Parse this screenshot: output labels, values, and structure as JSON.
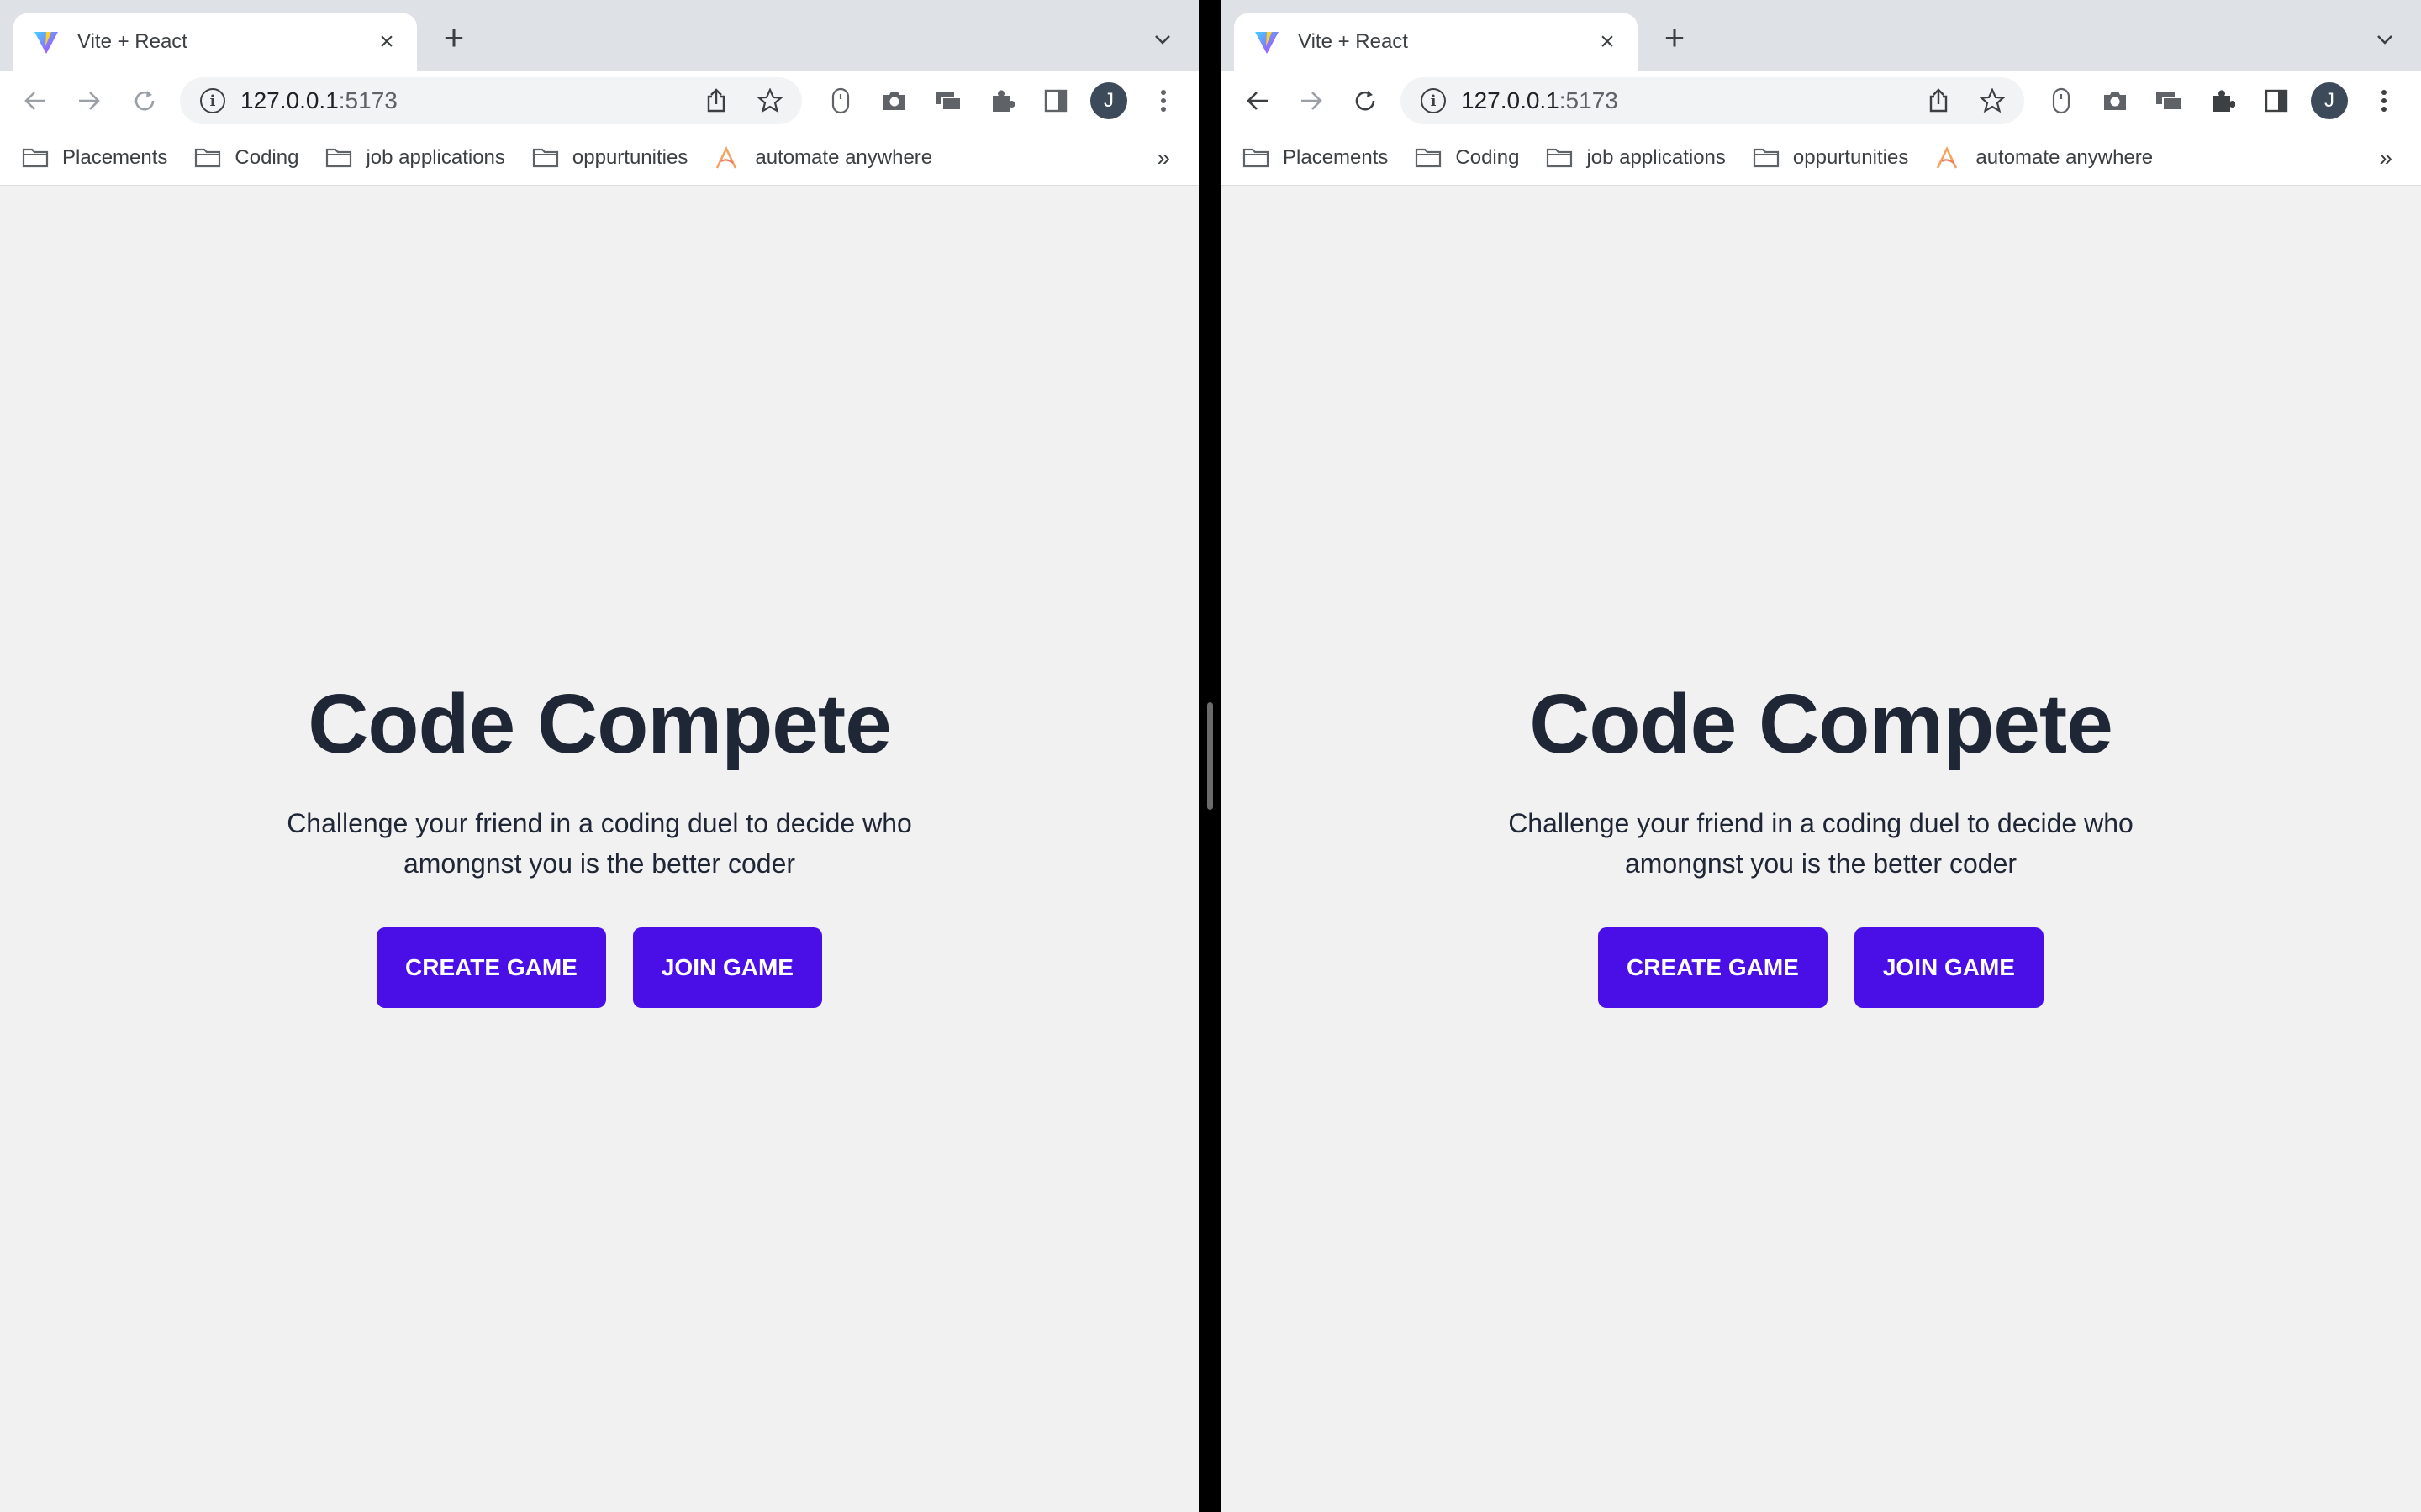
{
  "colors": {
    "accent": "#4a0fe6",
    "heading": "#1f2635",
    "page_bg": "#f1f1f2",
    "tabstrip_bg": "#dee1e6"
  },
  "windows": [
    {
      "tab": {
        "title": "Vite + React",
        "close": "×",
        "favicon": "vite-icon"
      },
      "new_tab": "+",
      "omnibox": {
        "host": "127.0.0.1",
        "port": ":5173",
        "info": "i"
      },
      "avatar": "J",
      "bookmarks": [
        {
          "label": "Placements",
          "icon": "folder-icon"
        },
        {
          "label": "Coding",
          "icon": "folder-icon"
        },
        {
          "label": "job applications",
          "icon": "folder-icon"
        },
        {
          "label": "oppurtunities",
          "icon": "folder-icon"
        },
        {
          "label": "automate anywhere",
          "icon": "automation-anywhere-icon"
        }
      ],
      "bookmarks_more": "»",
      "page": {
        "title": "Code Compete",
        "description": "Challenge your friend in a coding duel to decide who amongnst you is the better coder",
        "create_button": "CREATE GAME",
        "join_button": "JOIN GAME"
      }
    },
    {
      "tab": {
        "title": "Vite + React",
        "close": "×",
        "favicon": "vite-icon"
      },
      "new_tab": "+",
      "omnibox": {
        "host": "127.0.0.1",
        "port": ":5173",
        "info": "i"
      },
      "avatar": "J",
      "bookmarks": [
        {
          "label": "Placements",
          "icon": "folder-icon"
        },
        {
          "label": "Coding",
          "icon": "folder-icon"
        },
        {
          "label": "job applications",
          "icon": "folder-icon"
        },
        {
          "label": "oppurtunities",
          "icon": "folder-icon"
        },
        {
          "label": "automate anywhere",
          "icon": "automation-anywhere-icon"
        }
      ],
      "bookmarks_more": "»",
      "page": {
        "title": "Code Compete",
        "description": "Challenge your friend in a coding duel to decide who amongnst you is the better coder",
        "create_button": "CREATE GAME",
        "join_button": "JOIN GAME"
      }
    }
  ]
}
